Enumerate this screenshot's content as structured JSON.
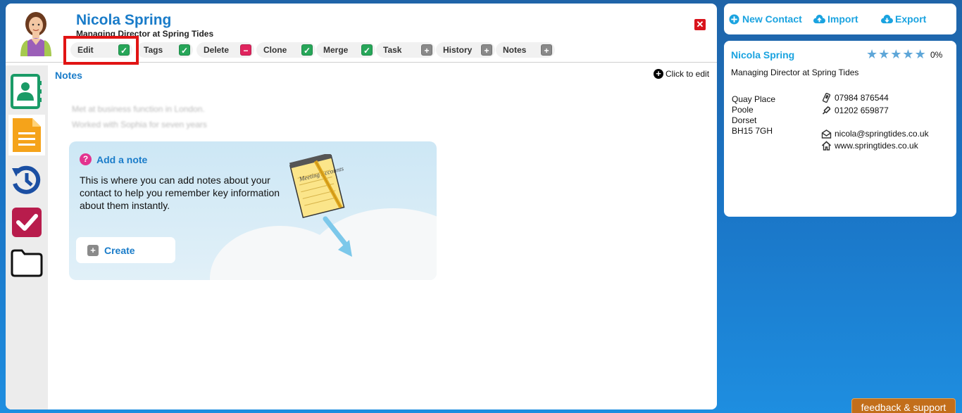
{
  "contact": {
    "name": "Nicola Spring",
    "title": "Managing Director at Spring Tides"
  },
  "actions": [
    {
      "label": "Edit",
      "state": "check"
    },
    {
      "label": "Tags",
      "state": "check"
    },
    {
      "label": "Delete",
      "state": "minus"
    },
    {
      "label": "Clone",
      "state": "check"
    },
    {
      "label": "Merge",
      "state": "check"
    },
    {
      "label": "Task",
      "state": "plus"
    },
    {
      "label": "History",
      "state": "plus"
    },
    {
      "label": "Notes",
      "state": "plus"
    }
  ],
  "sidebar": {
    "items": [
      {
        "icon": "contact-card-icon",
        "color": "#1a9b67"
      },
      {
        "icon": "document-icon",
        "color": "#f5a31a",
        "active": true
      },
      {
        "icon": "history-icon",
        "color": "#1b4fa3"
      },
      {
        "icon": "task-check-icon",
        "color": "#b81c4c"
      },
      {
        "icon": "folder-icon",
        "color": "#111111"
      }
    ]
  },
  "notes": {
    "title": "Notes",
    "click_to_edit": "Click to edit",
    "lines": [
      "Met at business function in London.",
      "Worked with Sophia for seven years"
    ],
    "add_note": {
      "title": "Add a note",
      "body": "This is where you can add notes about your contact to help you remember key information about them instantly.",
      "create_label": "Create",
      "illustration_text": "Meeting Accounts"
    }
  },
  "top_links": {
    "new_contact": "New Contact",
    "import": "Import",
    "export": "Export"
  },
  "card": {
    "name": "Nicola Spring",
    "rating": "0%",
    "stars": 5,
    "title": "Managing Director at Spring Tides",
    "address": [
      "Quay Place",
      "Poole",
      "Dorset",
      "BH15 7GH"
    ],
    "mobile": "07984 876544",
    "phone": "01202 659877",
    "email": "nicola@springtides.co.uk",
    "website": "www.springtides.co.uk"
  },
  "feedback_label": "feedback & support",
  "colors": {
    "brand_blue": "#1a7cc9",
    "link_blue": "#1aa3e0",
    "highlight_red": "#e11414",
    "feedback_orange": "#c26e1a"
  }
}
